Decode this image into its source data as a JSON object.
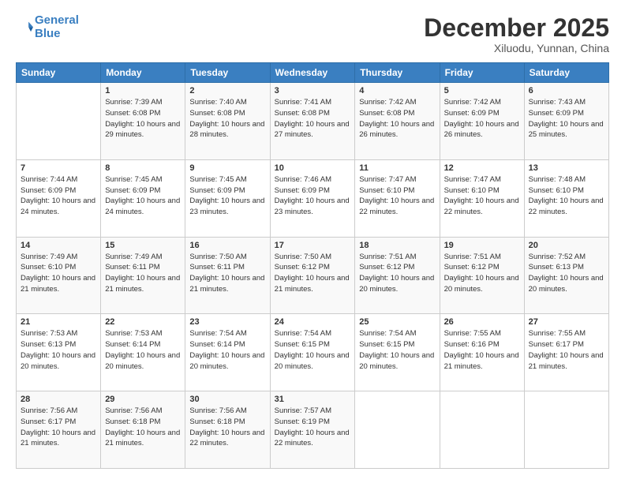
{
  "logo": {
    "line1": "General",
    "line2": "Blue"
  },
  "title": "December 2025",
  "subtitle": "Xiluodu, Yunnan, China",
  "days_header": [
    "Sunday",
    "Monday",
    "Tuesday",
    "Wednesday",
    "Thursday",
    "Friday",
    "Saturday"
  ],
  "weeks": [
    [
      {
        "num": "",
        "sunrise": "",
        "sunset": "",
        "daylight": ""
      },
      {
        "num": "1",
        "sunrise": "Sunrise: 7:39 AM",
        "sunset": "Sunset: 6:08 PM",
        "daylight": "Daylight: 10 hours and 29 minutes."
      },
      {
        "num": "2",
        "sunrise": "Sunrise: 7:40 AM",
        "sunset": "Sunset: 6:08 PM",
        "daylight": "Daylight: 10 hours and 28 minutes."
      },
      {
        "num": "3",
        "sunrise": "Sunrise: 7:41 AM",
        "sunset": "Sunset: 6:08 PM",
        "daylight": "Daylight: 10 hours and 27 minutes."
      },
      {
        "num": "4",
        "sunrise": "Sunrise: 7:42 AM",
        "sunset": "Sunset: 6:08 PM",
        "daylight": "Daylight: 10 hours and 26 minutes."
      },
      {
        "num": "5",
        "sunrise": "Sunrise: 7:42 AM",
        "sunset": "Sunset: 6:09 PM",
        "daylight": "Daylight: 10 hours and 26 minutes."
      },
      {
        "num": "6",
        "sunrise": "Sunrise: 7:43 AM",
        "sunset": "Sunset: 6:09 PM",
        "daylight": "Daylight: 10 hours and 25 minutes."
      }
    ],
    [
      {
        "num": "7",
        "sunrise": "Sunrise: 7:44 AM",
        "sunset": "Sunset: 6:09 PM",
        "daylight": "Daylight: 10 hours and 24 minutes."
      },
      {
        "num": "8",
        "sunrise": "Sunrise: 7:45 AM",
        "sunset": "Sunset: 6:09 PM",
        "daylight": "Daylight: 10 hours and 24 minutes."
      },
      {
        "num": "9",
        "sunrise": "Sunrise: 7:45 AM",
        "sunset": "Sunset: 6:09 PM",
        "daylight": "Daylight: 10 hours and 23 minutes."
      },
      {
        "num": "10",
        "sunrise": "Sunrise: 7:46 AM",
        "sunset": "Sunset: 6:09 PM",
        "daylight": "Daylight: 10 hours and 23 minutes."
      },
      {
        "num": "11",
        "sunrise": "Sunrise: 7:47 AM",
        "sunset": "Sunset: 6:10 PM",
        "daylight": "Daylight: 10 hours and 22 minutes."
      },
      {
        "num": "12",
        "sunrise": "Sunrise: 7:47 AM",
        "sunset": "Sunset: 6:10 PM",
        "daylight": "Daylight: 10 hours and 22 minutes."
      },
      {
        "num": "13",
        "sunrise": "Sunrise: 7:48 AM",
        "sunset": "Sunset: 6:10 PM",
        "daylight": "Daylight: 10 hours and 22 minutes."
      }
    ],
    [
      {
        "num": "14",
        "sunrise": "Sunrise: 7:49 AM",
        "sunset": "Sunset: 6:10 PM",
        "daylight": "Daylight: 10 hours and 21 minutes."
      },
      {
        "num": "15",
        "sunrise": "Sunrise: 7:49 AM",
        "sunset": "Sunset: 6:11 PM",
        "daylight": "Daylight: 10 hours and 21 minutes."
      },
      {
        "num": "16",
        "sunrise": "Sunrise: 7:50 AM",
        "sunset": "Sunset: 6:11 PM",
        "daylight": "Daylight: 10 hours and 21 minutes."
      },
      {
        "num": "17",
        "sunrise": "Sunrise: 7:50 AM",
        "sunset": "Sunset: 6:12 PM",
        "daylight": "Daylight: 10 hours and 21 minutes."
      },
      {
        "num": "18",
        "sunrise": "Sunrise: 7:51 AM",
        "sunset": "Sunset: 6:12 PM",
        "daylight": "Daylight: 10 hours and 20 minutes."
      },
      {
        "num": "19",
        "sunrise": "Sunrise: 7:51 AM",
        "sunset": "Sunset: 6:12 PM",
        "daylight": "Daylight: 10 hours and 20 minutes."
      },
      {
        "num": "20",
        "sunrise": "Sunrise: 7:52 AM",
        "sunset": "Sunset: 6:13 PM",
        "daylight": "Daylight: 10 hours and 20 minutes."
      }
    ],
    [
      {
        "num": "21",
        "sunrise": "Sunrise: 7:53 AM",
        "sunset": "Sunset: 6:13 PM",
        "daylight": "Daylight: 10 hours and 20 minutes."
      },
      {
        "num": "22",
        "sunrise": "Sunrise: 7:53 AM",
        "sunset": "Sunset: 6:14 PM",
        "daylight": "Daylight: 10 hours and 20 minutes."
      },
      {
        "num": "23",
        "sunrise": "Sunrise: 7:54 AM",
        "sunset": "Sunset: 6:14 PM",
        "daylight": "Daylight: 10 hours and 20 minutes."
      },
      {
        "num": "24",
        "sunrise": "Sunrise: 7:54 AM",
        "sunset": "Sunset: 6:15 PM",
        "daylight": "Daylight: 10 hours and 20 minutes."
      },
      {
        "num": "25",
        "sunrise": "Sunrise: 7:54 AM",
        "sunset": "Sunset: 6:15 PM",
        "daylight": "Daylight: 10 hours and 20 minutes."
      },
      {
        "num": "26",
        "sunrise": "Sunrise: 7:55 AM",
        "sunset": "Sunset: 6:16 PM",
        "daylight": "Daylight: 10 hours and 21 minutes."
      },
      {
        "num": "27",
        "sunrise": "Sunrise: 7:55 AM",
        "sunset": "Sunset: 6:17 PM",
        "daylight": "Daylight: 10 hours and 21 minutes."
      }
    ],
    [
      {
        "num": "28",
        "sunrise": "Sunrise: 7:56 AM",
        "sunset": "Sunset: 6:17 PM",
        "daylight": "Daylight: 10 hours and 21 minutes."
      },
      {
        "num": "29",
        "sunrise": "Sunrise: 7:56 AM",
        "sunset": "Sunset: 6:18 PM",
        "daylight": "Daylight: 10 hours and 21 minutes."
      },
      {
        "num": "30",
        "sunrise": "Sunrise: 7:56 AM",
        "sunset": "Sunset: 6:18 PM",
        "daylight": "Daylight: 10 hours and 22 minutes."
      },
      {
        "num": "31",
        "sunrise": "Sunrise: 7:57 AM",
        "sunset": "Sunset: 6:19 PM",
        "daylight": "Daylight: 10 hours and 22 minutes."
      },
      {
        "num": "",
        "sunrise": "",
        "sunset": "",
        "daylight": ""
      },
      {
        "num": "",
        "sunrise": "",
        "sunset": "",
        "daylight": ""
      },
      {
        "num": "",
        "sunrise": "",
        "sunset": "",
        "daylight": ""
      }
    ]
  ]
}
